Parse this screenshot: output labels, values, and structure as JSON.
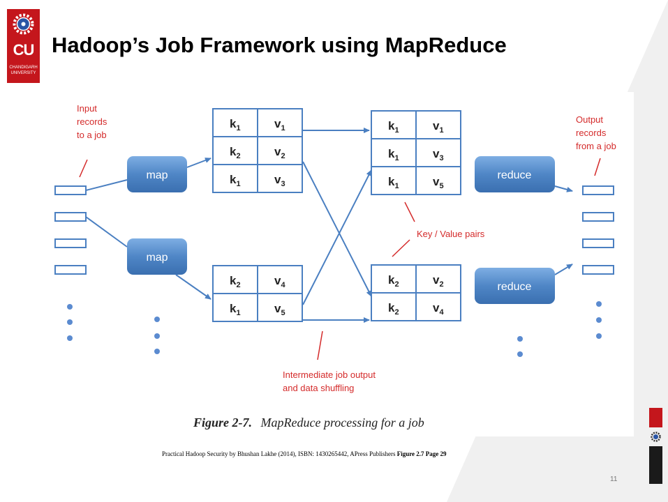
{
  "slide": {
    "title": "Hadoop’s Job Framework using MapReduce",
    "logo_text": "CU",
    "logo_subtext_1": "CHANDIGARH",
    "logo_subtext_2": "UNIVERSITY",
    "page_number": "11"
  },
  "citation": {
    "text": "Practical Hadoop Security by Bhushan Lakhe (2014), ISBN: 1430265442, APress Publishers ",
    "bold": "Figure 2.7 Page 29"
  },
  "diagram": {
    "caption_number": "Figure 2-7.",
    "caption_text": "MapReduce processing for a job",
    "annotations": {
      "input_1": "Input",
      "input_2": "records",
      "input_3": "to a job",
      "output_1": "Output",
      "output_2": "records",
      "output_3": "from a job",
      "kv_pairs": "Key / Value pairs",
      "intermediate_1": "Intermediate job output",
      "intermediate_2": "and data shuffling"
    },
    "map_label": "map",
    "reduce_label": "reduce",
    "map_table_1": [
      [
        "k1",
        "v1"
      ],
      [
        "k2",
        "v2"
      ],
      [
        "k1",
        "v3"
      ]
    ],
    "map_table_2": [
      [
        "k2",
        "v4"
      ],
      [
        "k1",
        "v5"
      ]
    ],
    "reduce_table_1": [
      [
        "k1",
        "v1"
      ],
      [
        "k1",
        "v3"
      ],
      [
        "k1",
        "v5"
      ]
    ],
    "reduce_table_2": [
      [
        "k2",
        "v2"
      ],
      [
        "k2",
        "v4"
      ]
    ],
    "colors": {
      "accent_red": "#c4161c",
      "annotation_red": "#d42a2a",
      "node_blue": "#4f86c6",
      "arrow_blue": "#4a7fc1"
    }
  }
}
